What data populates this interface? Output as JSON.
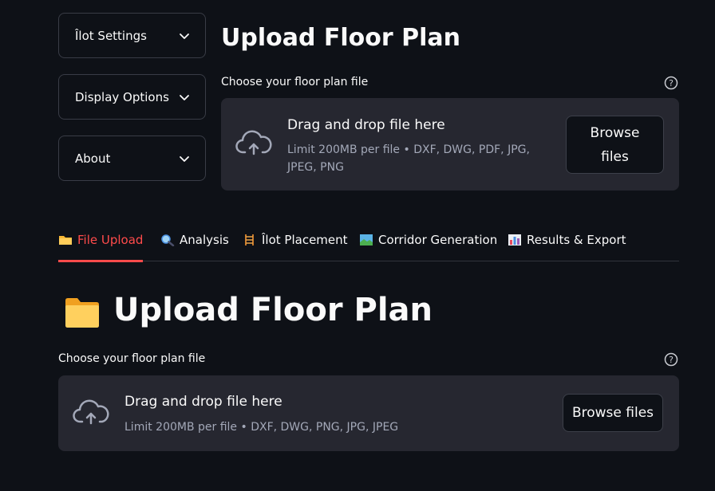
{
  "sidebar": {
    "expanders": [
      {
        "label": "Îlot Settings"
      },
      {
        "label": "Display Options"
      },
      {
        "label": "About"
      }
    ]
  },
  "top_section": {
    "title": "Upload Floor Plan",
    "uploader_label": "Choose your floor plan file",
    "dropzone_title": "Drag and drop file here",
    "dropzone_limit": "Limit 200MB per file • DXF, DWG, PDF, JPG, JPEG, PNG",
    "browse_label": "Browse files"
  },
  "tabs": [
    {
      "label": "File Upload",
      "icon": "folder-icon",
      "active": true
    },
    {
      "label": "Analysis",
      "icon": "magnifier-icon",
      "active": false
    },
    {
      "label": "Îlot Placement",
      "icon": "ladder-icon",
      "active": false
    },
    {
      "label": "Corridor Generation",
      "icon": "landscape-icon",
      "active": false
    },
    {
      "label": "Results & Export",
      "icon": "bar-chart-icon",
      "active": false
    }
  ],
  "main_section": {
    "title": "Upload Floor Plan",
    "title_icon": "folder-icon",
    "uploader_label": "Choose your floor plan file",
    "dropzone_title": "Drag and drop file here",
    "dropzone_limit": "Limit 200MB per file • DXF, DWG, PNG, JPG, JPEG",
    "browse_label": "Browse files"
  },
  "colors": {
    "background": "#0e1117",
    "surface": "#262730",
    "accent": "#ff4b4b",
    "border": "#393c46",
    "muted_text": "#a3a8b8"
  }
}
